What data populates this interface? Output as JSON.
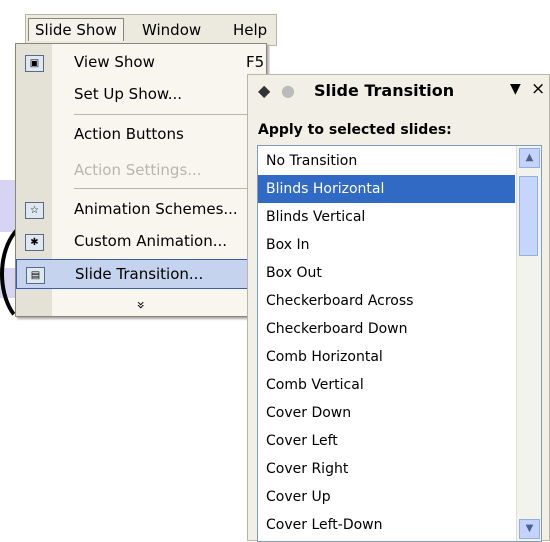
{
  "menubar": {
    "items": [
      {
        "label": "Slide Show",
        "active": true
      },
      {
        "label": "Window",
        "active": false
      },
      {
        "label": "Help",
        "active": false
      }
    ]
  },
  "dropdown": {
    "items": [
      {
        "label": "View Show",
        "shortcut": "F5",
        "icon": "projector-icon",
        "disabled": false,
        "selected": false
      },
      {
        "label": "Set Up Show...",
        "shortcut": "",
        "icon": "",
        "disabled": false,
        "selected": false
      },
      {
        "label": "Action Buttons",
        "shortcut": "",
        "icon": "",
        "disabled": false,
        "selected": false
      },
      {
        "label": "Action Settings...",
        "shortcut": "",
        "icon": "",
        "disabled": true,
        "selected": false
      },
      {
        "label": "Animation Schemes...",
        "shortcut": "",
        "icon": "animation-schemes-icon",
        "disabled": false,
        "selected": false
      },
      {
        "label": "Custom Animation...",
        "shortcut": "",
        "icon": "custom-animation-icon",
        "disabled": false,
        "selected": false
      },
      {
        "label": "Slide Transition...",
        "shortcut": "",
        "icon": "slide-transition-icon",
        "disabled": false,
        "selected": true
      }
    ],
    "expand_glyph": "»"
  },
  "taskpane": {
    "title": "Slide Transition",
    "apply_label": "Apply to selected slides:",
    "transitions": [
      "No Transition",
      "Blinds Horizontal",
      "Blinds Vertical",
      "Box In",
      "Box Out",
      "Checkerboard Across",
      "Checkerboard Down",
      "Comb Horizontal",
      "Comb Vertical",
      "Cover Down",
      "Cover Left",
      "Cover Right",
      "Cover Up",
      "Cover Left-Down"
    ],
    "selected_transition": "Blinds Horizontal"
  },
  "colors": {
    "selection": "#316ac5",
    "menu_highlight": "#c6d3ef",
    "pane_bg": "#f2f0e6"
  }
}
